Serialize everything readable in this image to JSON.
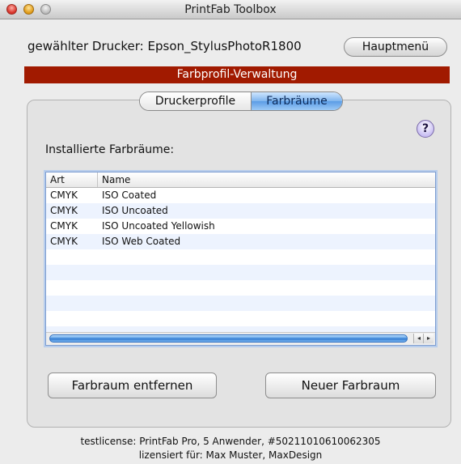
{
  "window": {
    "title": "PrintFab Toolbox"
  },
  "printer": {
    "label": "gewählter Drucker: Epson_StylusPhotoR1800",
    "main_menu_label": "Hauptmenü"
  },
  "section": {
    "header": "Farbprofil-Verwaltung"
  },
  "tabs": [
    {
      "label": "Druckerprofile",
      "active": false
    },
    {
      "label": "Farbräume",
      "active": true
    }
  ],
  "help": {
    "label": "?"
  },
  "colorspaces": {
    "label": "Installierte Farbräume:",
    "columns": [
      "Art",
      "Name"
    ],
    "rows": [
      {
        "art": "CMYK",
        "name": "ISO Coated"
      },
      {
        "art": "CMYK",
        "name": "ISO Uncoated"
      },
      {
        "art": "CMYK",
        "name": "ISO Uncoated Yellowish"
      },
      {
        "art": "CMYK",
        "name": "ISO Web Coated"
      }
    ]
  },
  "buttons": {
    "remove": "Farbraum entfernen",
    "new": "Neuer Farbraum"
  },
  "footer": {
    "license": "testlicense: PrintFab Pro, 5 Anwender, #50211010610062305",
    "licensed_to": "lizensiert für: Max Muster, MaxDesign"
  },
  "colors": {
    "header_red": "#a11a00",
    "active_tab": "#5b9de6"
  }
}
